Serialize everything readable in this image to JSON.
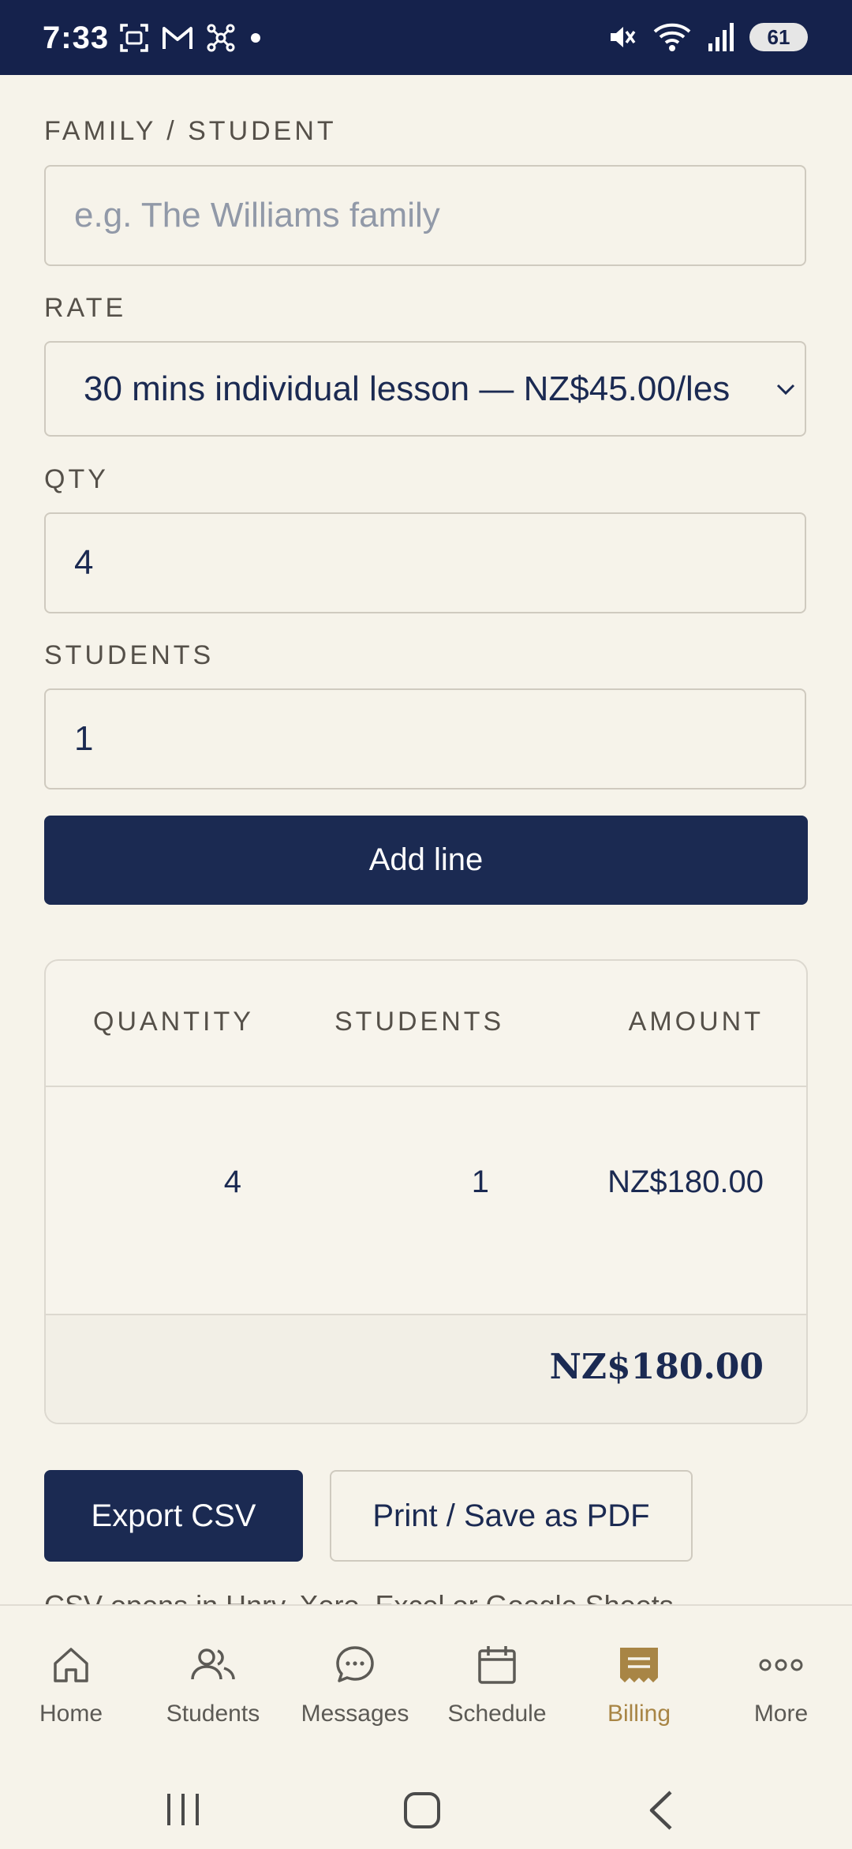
{
  "status": {
    "time": "7:33",
    "battery": "61"
  },
  "form": {
    "family_label": "FAMILY / STUDENT",
    "family_placeholder": "e.g. The Williams family",
    "rate_label": "RATE",
    "rate_value": "30 mins individual lesson — NZ$45.00/les",
    "qty_label": "QTY",
    "qty_value": "4",
    "students_label": "STUDENTS",
    "students_value": "1",
    "add_button": "Add line"
  },
  "table": {
    "headers": [
      "QUANTITY",
      "STUDENTS",
      "AMOUNT"
    ],
    "rows": [
      {
        "quantity": "4",
        "students": "1",
        "amount": "NZ$180.00"
      }
    ],
    "total": "NZ$180.00"
  },
  "actions": {
    "export_csv": "Export CSV",
    "print_pdf": "Print / Save as PDF",
    "note": "CSV opens in Hnry, Xero, Excel or Google Sheets"
  },
  "nav": {
    "items": [
      {
        "label": "Home",
        "icon": "home-icon"
      },
      {
        "label": "Students",
        "icon": "students-icon"
      },
      {
        "label": "Messages",
        "icon": "messages-icon"
      },
      {
        "label": "Schedule",
        "icon": "calendar-icon"
      },
      {
        "label": "Billing",
        "icon": "billing-icon",
        "active": true
      },
      {
        "label": "More",
        "icon": "more-icon"
      }
    ]
  },
  "colors": {
    "primary": "#1b2a52",
    "accent": "#a88545",
    "background": "#f6f3ea",
    "status_bar": "#15224c"
  }
}
